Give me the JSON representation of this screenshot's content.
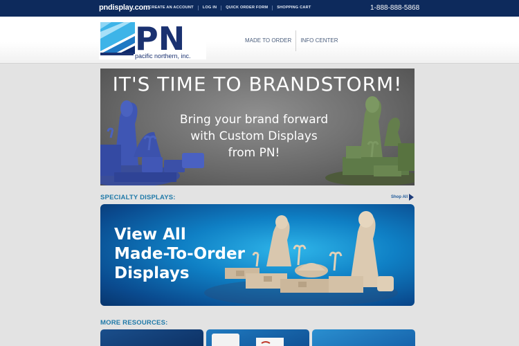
{
  "topbar": {
    "site": "pndisplay.com",
    "links": [
      "CREATE AN ACCOUNT",
      "LOG IN",
      "QUICK ORDER FORM",
      "SHOPPING CART"
    ],
    "phone": "1-888-888-5868"
  },
  "header": {
    "logo_letters": "PN",
    "logo_tagline": "pacific northern, inc.",
    "nav": [
      "MADE TO ORDER",
      "INFO CENTER"
    ]
  },
  "hero": {
    "title": "IT'S TIME TO BRANDSTORM!",
    "subtitle_1": "Bring your brand forward",
    "subtitle_2": "with Custom Displays",
    "subtitle_3": "from PN!"
  },
  "specialty": {
    "heading": "SPECIALTY DISPLAYS:",
    "shop_all": "Shop All",
    "banner_line_1": "View All",
    "banner_line_2": "Made-To-Order",
    "banner_line_3": "Displays"
  },
  "resources": {
    "heading": "MORE RESOURCES:"
  },
  "colors": {
    "topbar": "#0d2a5c",
    "accent": "#1f79a8",
    "brand_blue": "#1e3c7a"
  }
}
